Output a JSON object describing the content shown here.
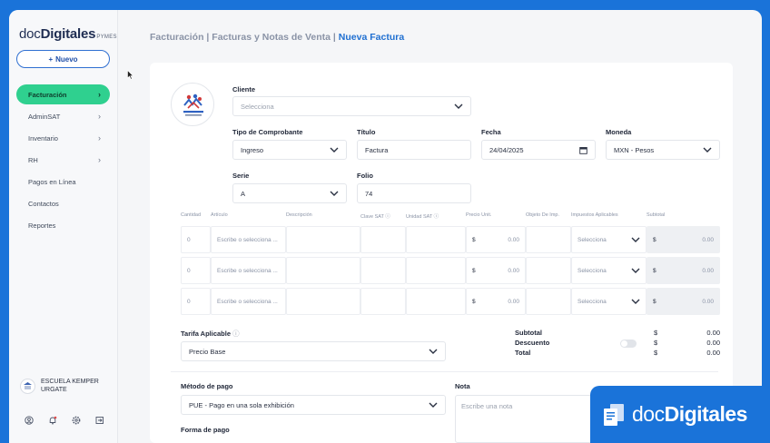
{
  "sidebar": {
    "logo_prefix": "doc",
    "logo_bold": "Digitales",
    "logo_suffix": "PYMES",
    "new_button": "Nuevo",
    "items": [
      {
        "label": "Facturación",
        "chevron": true,
        "active": true
      },
      {
        "label": "AdminSAT",
        "chevron": true
      },
      {
        "label": "Inventario",
        "chevron": true
      },
      {
        "label": "RH",
        "chevron": true
      },
      {
        "label": "Pagos en Línea",
        "chevron": false
      },
      {
        "label": "Contactos",
        "chevron": false
      },
      {
        "label": "Reportes",
        "chevron": false
      }
    ],
    "company": "ESCUELA KEMPER URGATE",
    "bottom_icons": [
      "user-icon",
      "bell-icon",
      "settings-icon",
      "logout-icon"
    ]
  },
  "breadcrumb": {
    "part1": "Facturación",
    "sep": " | ",
    "part2": "Facturas y Notas de Venta",
    "current": "Nueva Factura"
  },
  "form": {
    "cliente_label": "Cliente",
    "cliente_placeholder": "Selecciona",
    "tipo_label": "Tipo de Comprobante",
    "tipo_value": "Ingreso",
    "titulo_label": "Título",
    "titulo_value": "Factura",
    "fecha_label": "Fecha",
    "fecha_value": "24/04/2025",
    "moneda_label": "Moneda",
    "moneda_value": "MXN - Pesos",
    "serie_label": "Serie",
    "serie_value": "A",
    "folio_label": "Folio",
    "folio_value": "74"
  },
  "table": {
    "headers": [
      "Cantidad",
      "Artículo",
      "Descripción",
      "Clave SAT",
      "Unidad SAT",
      "Precio Unit.",
      "Objeto De Imp.",
      "Impuestos Aplicables",
      "Subtotal"
    ],
    "rows": [
      {
        "cantidad": "0",
        "articulo": "Escribe o selecciona ...",
        "currency": "$",
        "precio": "0.00",
        "impuestos": "Selecciona",
        "subtotal": "0.00"
      },
      {
        "cantidad": "0",
        "articulo": "Escribe o selecciona ...",
        "currency": "$",
        "precio": "0.00",
        "impuestos": "Selecciona",
        "subtotal": "0.00"
      },
      {
        "cantidad": "0",
        "articulo": "Escribe o selecciona ...",
        "currency": "$",
        "precio": "0.00",
        "impuestos": "Selecciona",
        "subtotal": "0.00"
      }
    ]
  },
  "tarifa": {
    "label": "Tarifa Aplicable",
    "value": "Precio Base"
  },
  "totals": {
    "subtotal_label": "Subtotal",
    "descuento_label": "Descuento",
    "total_label": "Total",
    "currency": "$",
    "subtotal": "0.00",
    "descuento": "0.00",
    "total": "0.00"
  },
  "pago": {
    "metodo_label": "Método de pago",
    "metodo_value": "PUE - Pago en una sola exhibición",
    "forma_label": "Forma de pago",
    "nota_label": "Nota",
    "nota_placeholder": "Escribe una nota"
  },
  "watermark": {
    "prefix": "doc",
    "bold": "Digitales"
  },
  "colors": {
    "accent": "#1a73d9",
    "active_nav": "#2fd08f",
    "breadcrumb_current": "#1f6fd1"
  }
}
